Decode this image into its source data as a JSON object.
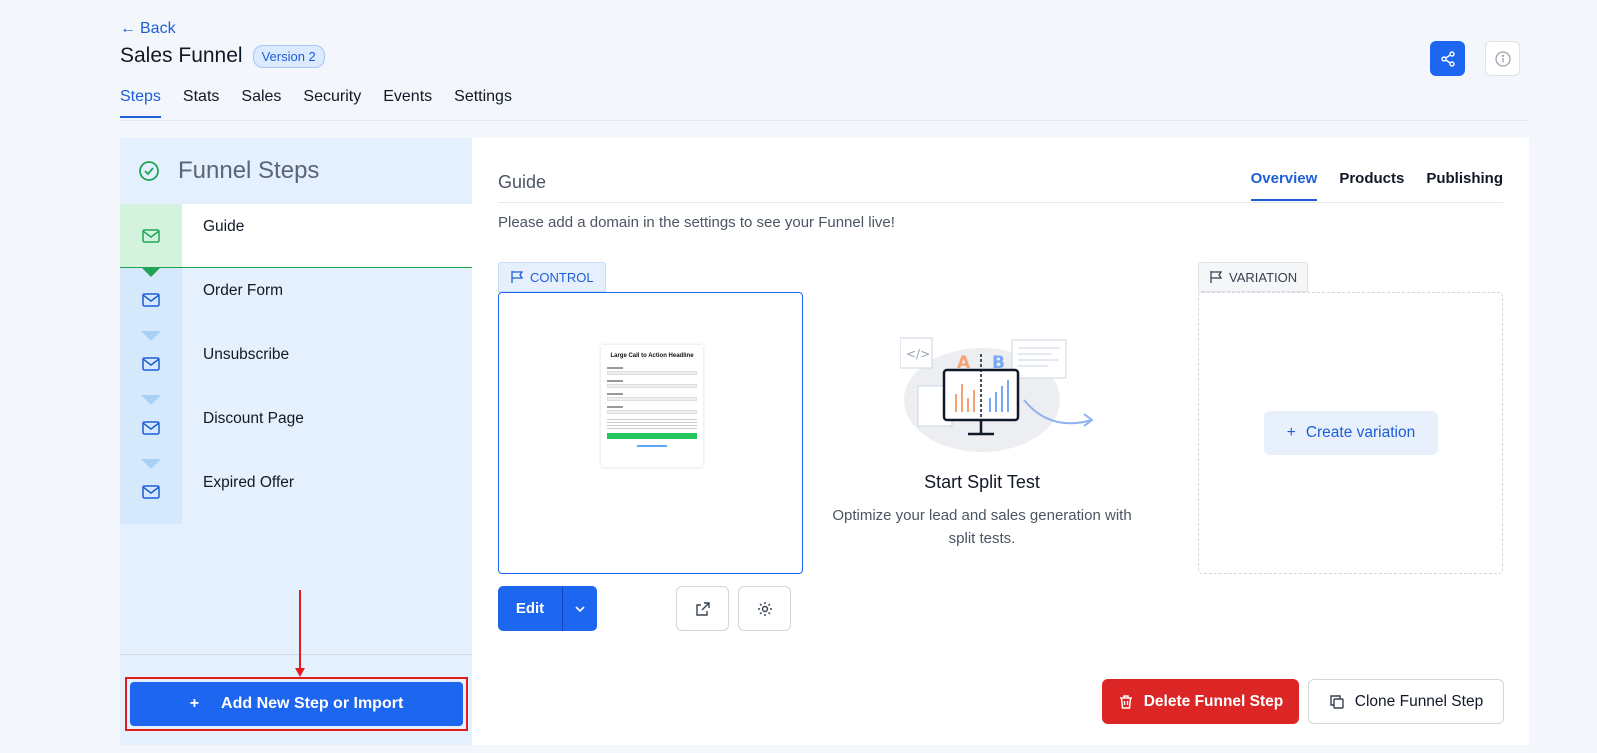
{
  "header": {
    "back_label": "Back",
    "title": "Sales Funnel",
    "version": "Version 2"
  },
  "tabs": [
    {
      "label": "Steps",
      "active": true
    },
    {
      "label": "Stats"
    },
    {
      "label": "Sales"
    },
    {
      "label": "Security"
    },
    {
      "label": "Events"
    },
    {
      "label": "Settings"
    }
  ],
  "sidebar": {
    "title": "Funnel Steps",
    "steps": [
      {
        "label": "Guide",
        "active": true
      },
      {
        "label": "Order Form"
      },
      {
        "label": "Unsubscribe"
      },
      {
        "label": "Discount Page"
      },
      {
        "label": "Expired Offer"
      }
    ],
    "add_label": "Add New Step or Import"
  },
  "main": {
    "title": "Guide",
    "tabs": [
      {
        "label": "Overview",
        "active": true
      },
      {
        "label": "Products"
      },
      {
        "label": "Publishing"
      }
    ],
    "notice": "Please add a domain in the settings to see your Funnel live!",
    "control_label": "CONTROL",
    "thumbnail_headline": "Large Call to Action Headline",
    "edit_label": "Edit",
    "split_title": "Start Split Test",
    "split_subtitle": "Optimize your lead and sales generation with split tests.",
    "split_letter_a": "A",
    "split_letter_b": "B",
    "variation_label": "VARIATION",
    "create_variation_label": "Create variation",
    "delete_label": "Delete Funnel Step",
    "clone_label": "Clone Funnel Step"
  },
  "colors": {
    "primary": "#1d66f0",
    "danger": "#dc2626",
    "success": "#16a34a",
    "annotation": "#e11d1d"
  }
}
